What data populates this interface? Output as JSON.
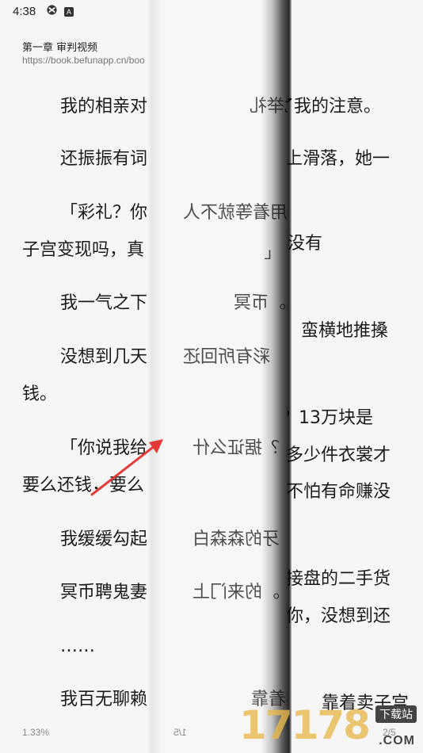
{
  "status_bar": {
    "time": "4:38",
    "left_icons": [
      "ring-icon",
      "a-icon"
    ],
    "right_icons": [
      "wifi-icon",
      "battery-icon"
    ]
  },
  "chapter": {
    "title": "第一章 审判视频",
    "url": "https://book.befunapp.cn/boo"
  },
  "left_page": {
    "lines": [
      "我的相亲对",
      "还振振有词",
      "「彩礼？你",
      "子宫变现吗，真",
      "我一气之下",
      "没想到几天",
      "钱。",
      "「你说我给",
      "要么还钱，要么",
      "我缓缓勾起",
      "冥币聘鬼妻",
      "……",
      "我百无聊赖"
    ],
    "progress": "1.33%"
  },
  "mid_page": {
    "lines": [
      "。此举礼",
      "用着等就不人",
      "L",
      "。币冥",
      "彩有所回还",
      "？据证么什",
      "。牙的森森白",
      "。的来门上",
      "。频视卖着靠"
    ],
    "page": "1/5"
  },
  "right_page": {
    "lines": [
      "了我的注意。",
      "上滑落，她一",
      "没有",
      "蛮横地推搡",
      "？13万块是",
      "多少件衣裳才",
      "不怕有命赚没",
      "接盘的二手货",
      "你，没想到还",
      "靠着卖子宫"
    ],
    "page": "2/5"
  },
  "watermark": {
    "number": "17178",
    "tag": "下载站",
    "domain": ".COM"
  },
  "annotation": {
    "arrow_color": "#e53935"
  }
}
